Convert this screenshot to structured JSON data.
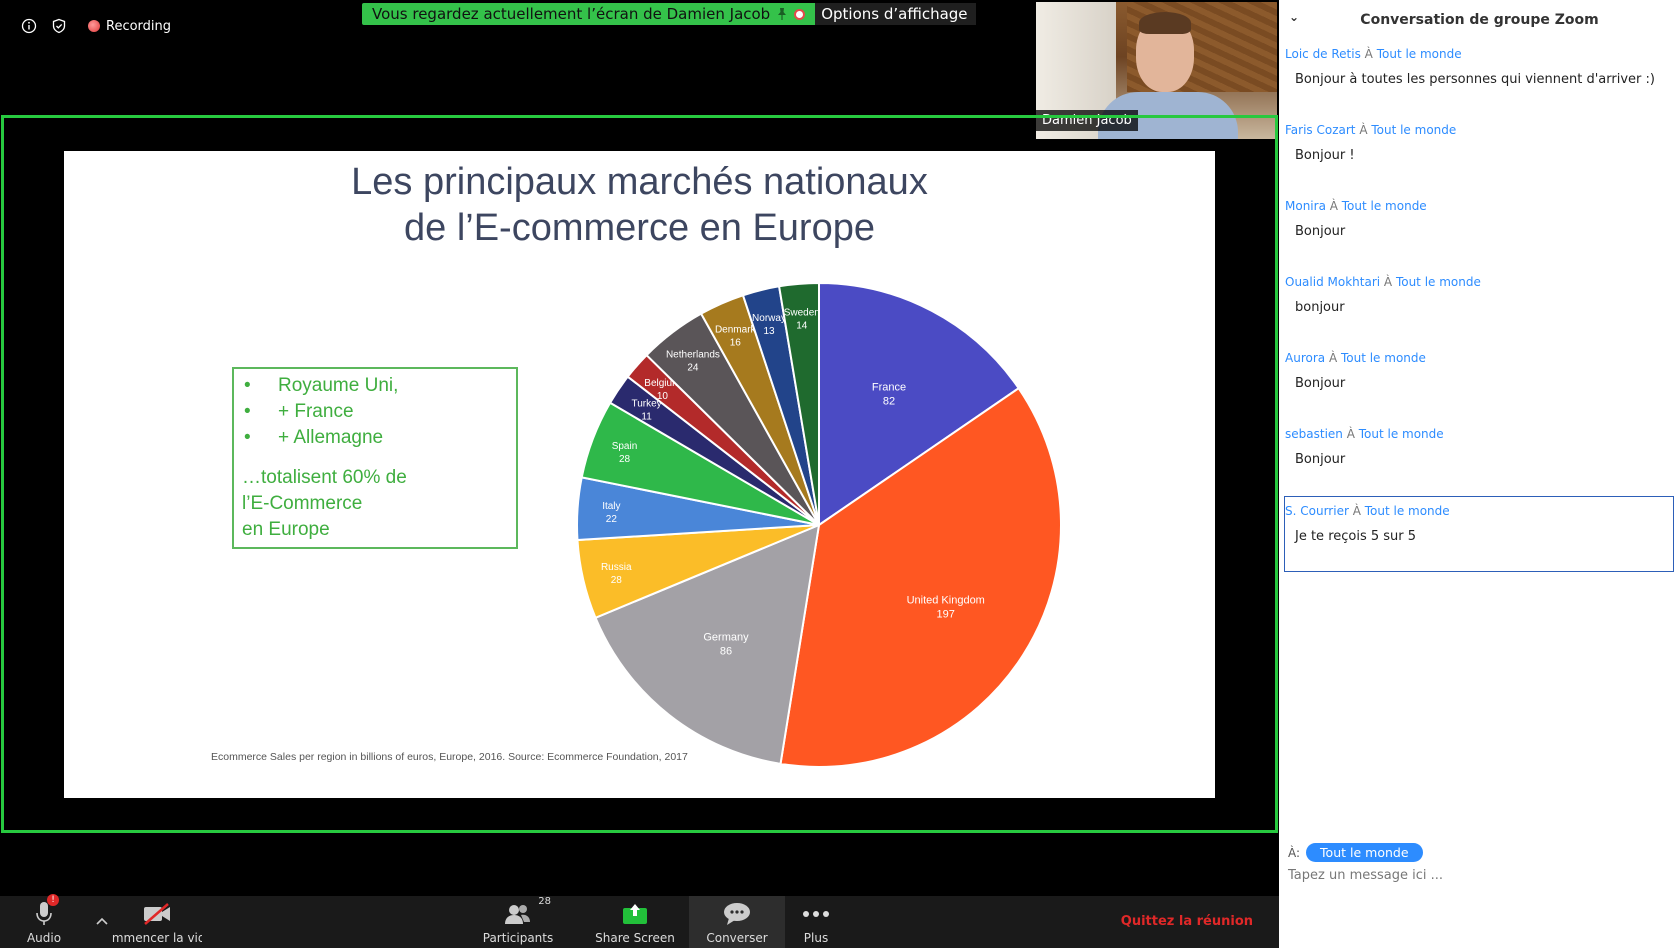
{
  "top": {
    "recording_label": "Recording"
  },
  "share_banner": {
    "text": "Vous regardez actuellement l’écran de Damien Jacob",
    "options_label": "Options d’affichage"
  },
  "video": {
    "participant_name": "Damien Jacob"
  },
  "slide": {
    "title": "Les principaux marchés nationaux\nde l’E-commerce en Europe",
    "callout_items": [
      "Royaume Uni,",
      "+ France",
      "+ Allemagne"
    ],
    "callout_bullet": "•",
    "callout_note": "…totalisent 60% de\nl’E-Commerce\nen Europe",
    "source": "Ecommerce Sales per region in billions of euros, Europe, 2016. Source: Ecommerce Foundation, 2017"
  },
  "chart_data": {
    "type": "pie",
    "unit": "billions of euros",
    "categories": [
      "France",
      "United Kingdom",
      "Germany",
      "Russia",
      "Italy",
      "Spain",
      "Turkey",
      "Belgium",
      "Netherlands",
      "Denmark",
      "Norway",
      "Sweden"
    ],
    "values": [
      82,
      197,
      86,
      28,
      22,
      28,
      11,
      10,
      24,
      16,
      13,
      14
    ],
    "colors": [
      "#4b4bc4",
      "#ff5722",
      "#a3a1a6",
      "#fbbd28",
      "#4a86d8",
      "#2fb84a",
      "#2a2a6e",
      "#b32a2a",
      "#5a5558",
      "#a67a1e",
      "#22448a",
      "#1f6a2e"
    ]
  },
  "chat": {
    "title": "Conversation de groupe Zoom",
    "collapse_glyph": "⌄",
    "sep": " À ",
    "messages": [
      {
        "from": "Loic de Retis",
        "to": "Tout le monde",
        "text": "Bonjour à toutes les personnes qui viennent d'arriver :)"
      },
      {
        "from": "Faris Cozart",
        "to": "Tout le monde",
        "text": "Bonjour !"
      },
      {
        "from": "Monira",
        "to": "Tout le monde",
        "text": "Bonjour"
      },
      {
        "from": "Oualid Mokhtari",
        "to": "Tout le monde",
        "text": "bonjour"
      },
      {
        "from": "Aurora",
        "to": "Tout le monde",
        "text": "Bonjour"
      },
      {
        "from": "sebastien",
        "to": "Tout le monde",
        "text": "Bonjour"
      },
      {
        "from": "S. Courrier",
        "to": "Tout le monde",
        "text": "Je te reçois 5 sur 5"
      }
    ],
    "to_label": "À:",
    "to_value": "Tout le monde",
    "input_placeholder": "Tapez un message ici ..."
  },
  "toolbar": {
    "audio": "Audio",
    "video": "ımmencer la vid",
    "participants": "Participants",
    "participants_count": "28",
    "share": "Share Screen",
    "chat": "Converser",
    "more": "Plus",
    "leave": "Quittez la réunion",
    "audio_badge": "!"
  },
  "colors": {
    "share_green": "#34c24a",
    "accent_blue": "#2d8cff",
    "leave_red": "#e02828"
  }
}
